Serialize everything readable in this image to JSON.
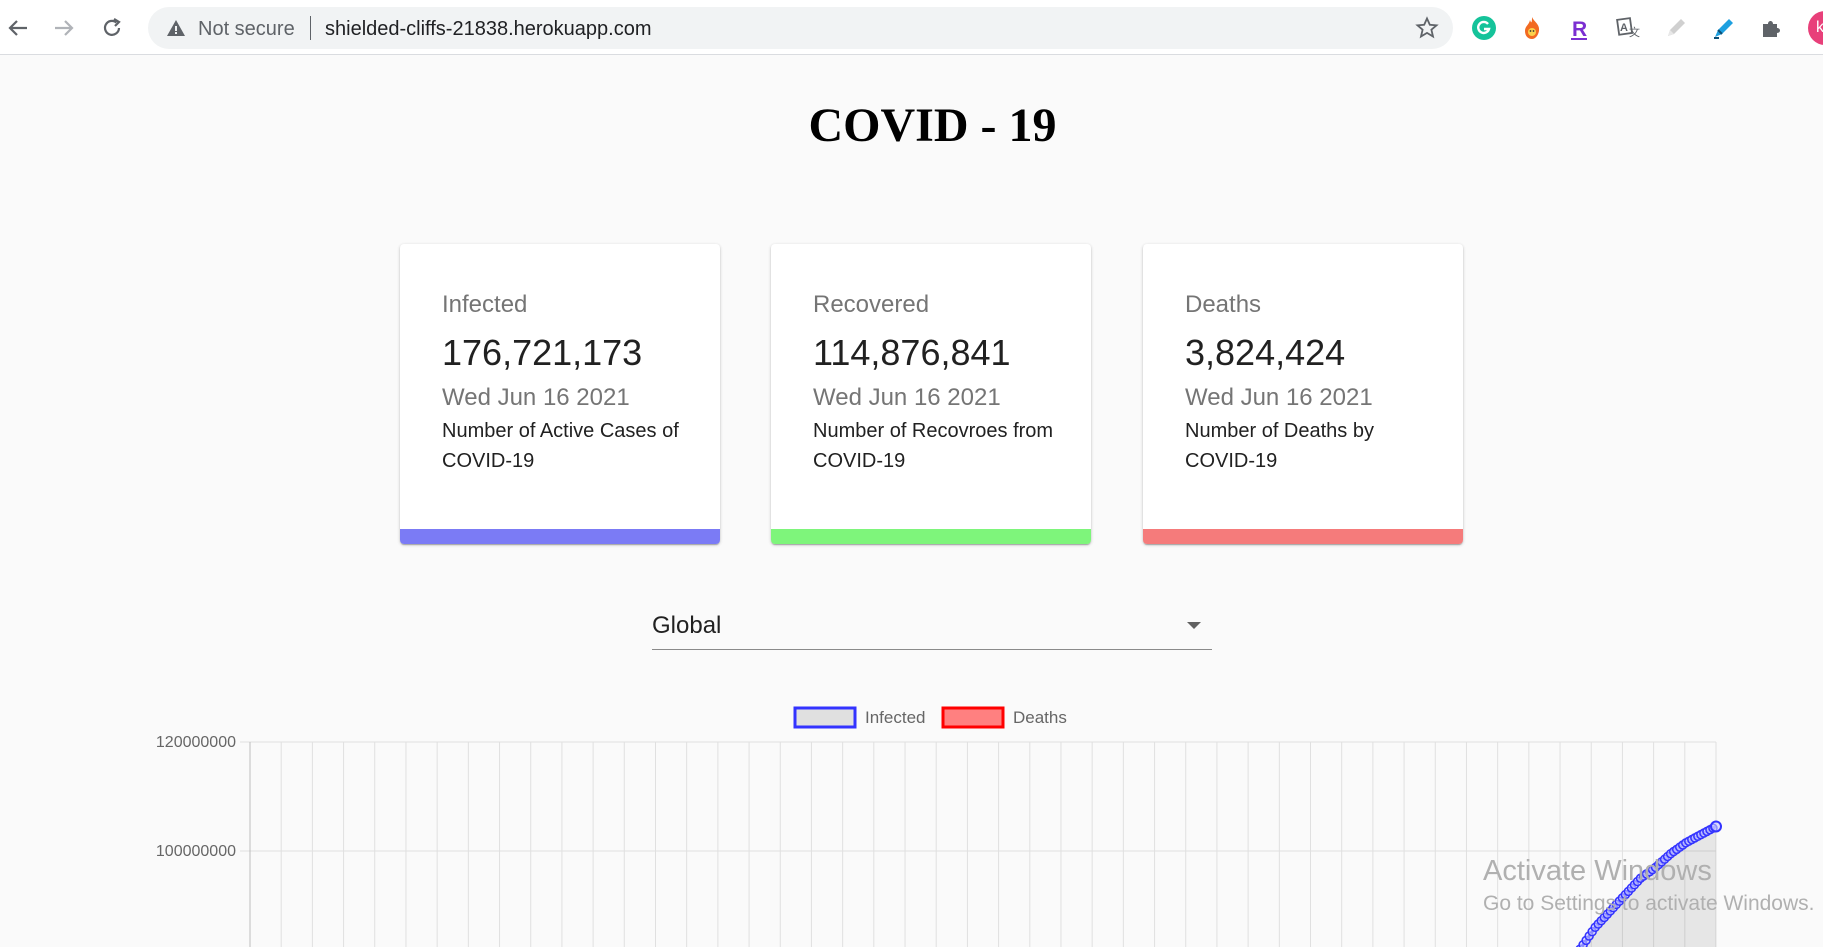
{
  "browser": {
    "status": "Not secure",
    "url": "shielded-cliffs-21838.herokuapp.com",
    "extensions": [
      "grammarly-icon",
      "fire-icon",
      "r-extension-icon",
      "translate-icon",
      "pencil-icon",
      "highlighter-icon",
      "puzzle-icon"
    ],
    "profile_initial": "k"
  },
  "page": {
    "title": "COVID - 19"
  },
  "cards": [
    {
      "label": "Infected",
      "value": "176,721,173",
      "date": "Wed Jun 16 2021",
      "description": "Number of Active Cases of COVID-19",
      "color": "#7b7bf5"
    },
    {
      "label": "Recovered",
      "value": "114,876,841",
      "date": "Wed Jun 16 2021",
      "description": "Number of Recovroes from COVID-19",
      "color": "#7ef57b"
    },
    {
      "label": "Deaths",
      "value": "3,824,424",
      "date": "Wed Jun 16 2021",
      "description": "Number of Deaths by COVID-19",
      "color": "#f57b7b"
    }
  ],
  "country_select": {
    "value": "Global"
  },
  "chart_data": {
    "type": "line",
    "legend": [
      "Infected",
      "Deaths"
    ],
    "legend_position": "top",
    "y_ticks": [
      "120000000",
      "100000000"
    ],
    "grid": true,
    "series": [
      {
        "name": "Infected",
        "color": "#3333ff",
        "fill": "rgba(0,0,0,0.1)",
        "visible_points": [
          [
            0,
            79000000
          ],
          [
            0.1,
            82000000
          ],
          [
            0.2,
            86000000
          ],
          [
            0.3,
            89000000
          ],
          [
            0.4,
            92000000
          ],
          [
            0.5,
            95000000
          ],
          [
            0.6,
            97000000
          ],
          [
            0.7,
            99500000
          ],
          [
            0.8,
            101500000
          ],
          [
            0.9,
            103000000
          ],
          [
            1.0,
            104500000
          ]
        ]
      },
      {
        "name": "Deaths",
        "color": "#ff0000",
        "fill": "rgba(255,0,0,0.5)"
      }
    ]
  },
  "watermark": {
    "line1": "Activate Windows",
    "line2": "Go to Settings to activate Windows."
  }
}
